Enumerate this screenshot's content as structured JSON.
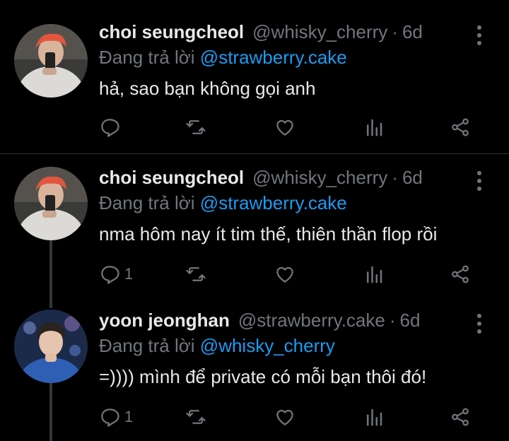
{
  "tweets": [
    {
      "name": "choi seungcheol",
      "handle": "@whisky_cherry",
      "dot": "·",
      "time": "6d",
      "reply_prefix": "Đang trả lời",
      "reply_to": "@strawberry.cake",
      "text": "hả, sao bạn không gọi anh",
      "reply_count": ""
    },
    {
      "name": "choi seungcheol",
      "handle": "@whisky_cherry",
      "dot": "·",
      "time": "6d",
      "reply_prefix": "Đang trả lời",
      "reply_to": "@strawberry.cake",
      "text": "nma hôm nay ít tim thế, thiên thần flop rồi",
      "reply_count": "1"
    },
    {
      "name": "yoon jeonghan",
      "handle": "@strawberry.cake",
      "dot": "·",
      "time": "6d",
      "reply_prefix": "Đang trả lời",
      "reply_to": "@whisky_cherry",
      "text": "=)))) mình để private có mỗi bạn thôi đó!",
      "reply_count": "1"
    }
  ],
  "colors": {
    "background": "#000000",
    "text": "#e7e9ea",
    "muted": "#71767b",
    "accent": "#1d9bf0",
    "divider": "#2f3336"
  },
  "icons": [
    "more-options-icon",
    "reply-icon",
    "retweet-icon",
    "like-icon",
    "views-icon",
    "share-icon"
  ]
}
